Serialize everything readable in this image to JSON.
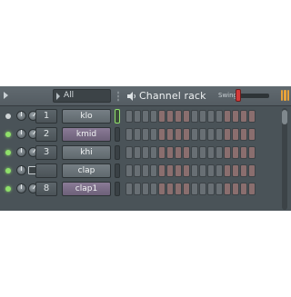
{
  "header": {
    "filter_value": "All",
    "title": "Channel rack",
    "swing_label": "Swing",
    "swing_value": 0
  },
  "channels": [
    {
      "number": "1",
      "name": "klo",
      "active": false,
      "selected": false,
      "focused": true
    },
    {
      "number": "2",
      "name": "kmid",
      "active": true,
      "selected": true,
      "focused": false
    },
    {
      "number": "3",
      "name": "khi",
      "active": true,
      "selected": false,
      "focused": false
    },
    {
      "number": "",
      "name": "clap",
      "active": true,
      "selected": false,
      "focused": false
    },
    {
      "number": "8",
      "name": "clap1",
      "active": true,
      "selected": true,
      "focused": false
    }
  ],
  "steps_per_row": 16,
  "colors": {
    "accent_red": "#d23a3a",
    "led_green": "#8fe06a",
    "pattern_orange": "#e8a33a"
  }
}
